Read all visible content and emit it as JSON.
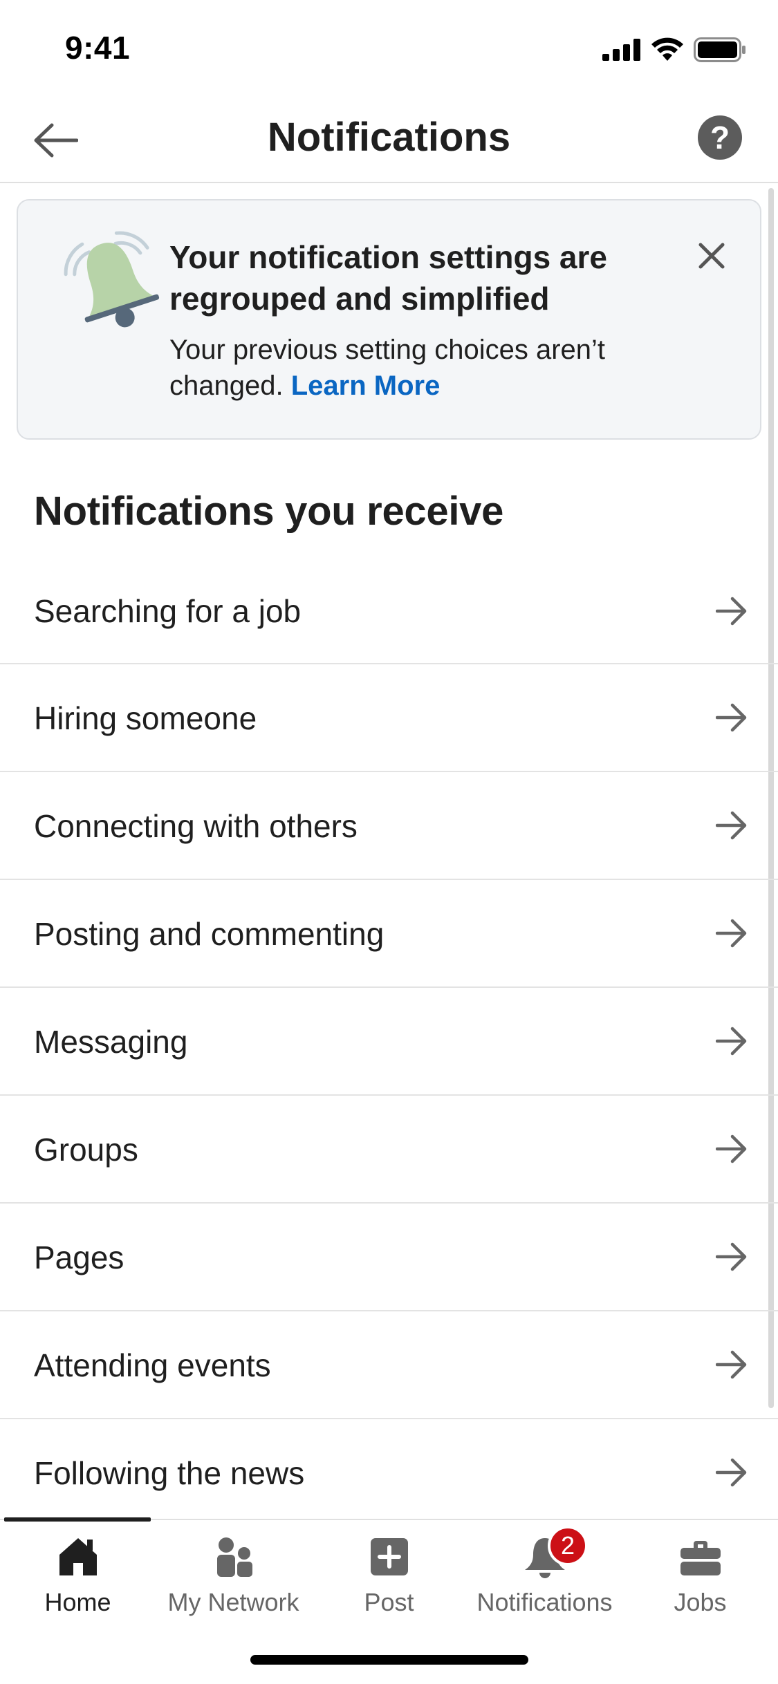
{
  "status_bar": {
    "time": "9:41",
    "icons": [
      "cellular-signal-icon",
      "wifi-icon",
      "battery-icon"
    ]
  },
  "header": {
    "title": "Notifications",
    "back_icon": "arrow-left-icon",
    "help_icon": "question-circle-icon",
    "help_glyph": "?"
  },
  "banner": {
    "illustration": "bell-ringing-icon",
    "title": "Your notification settings are regrouped and simplified",
    "body": "Your previous setting choices aren’t changed.",
    "link": "Learn More",
    "close_icon": "close-icon"
  },
  "section": {
    "heading": "Notifications you receive",
    "items": [
      {
        "label": "Searching for a job"
      },
      {
        "label": "Hiring someone"
      },
      {
        "label": "Connecting with others"
      },
      {
        "label": "Posting and commenting"
      },
      {
        "label": "Messaging"
      },
      {
        "label": "Groups"
      },
      {
        "label": "Pages"
      },
      {
        "label": "Attending events"
      },
      {
        "label": "Following the news"
      }
    ]
  },
  "tabs": [
    {
      "label": "Home",
      "icon": "home-icon",
      "active": true
    },
    {
      "label": "My Network",
      "icon": "people-icon",
      "active": false
    },
    {
      "label": "Post",
      "icon": "plus-square-icon",
      "active": false
    },
    {
      "label": "Notifications",
      "icon": "bell-icon",
      "active": false,
      "badge": "2"
    },
    {
      "label": "Jobs",
      "icon": "briefcase-icon",
      "active": false
    }
  ],
  "colors": {
    "accent_link": "#0a66c2",
    "badge": "#cc1016",
    "text_primary": "#1f1f1f",
    "text_secondary": "#666666",
    "banner_bg": "#f4f6f8"
  }
}
